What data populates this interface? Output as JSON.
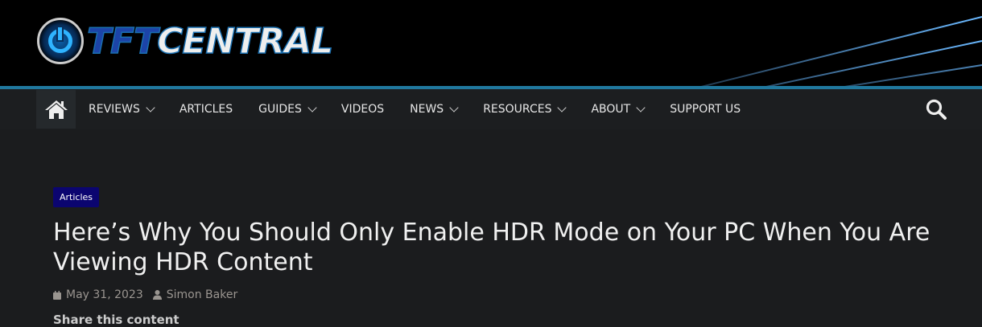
{
  "logo": {
    "part1": "TFT",
    "part2": "CENTRAL"
  },
  "nav": {
    "items": [
      {
        "label": "REVIEWS",
        "dropdown": true
      },
      {
        "label": "ARTICLES",
        "dropdown": false
      },
      {
        "label": "GUIDES",
        "dropdown": true
      },
      {
        "label": "VIDEOS",
        "dropdown": false
      },
      {
        "label": "NEWS",
        "dropdown": true
      },
      {
        "label": "RESOURCES",
        "dropdown": true
      },
      {
        "label": "ABOUT",
        "dropdown": true
      },
      {
        "label": "SUPPORT US",
        "dropdown": false
      }
    ]
  },
  "article": {
    "category": "Articles",
    "title": "Here’s Why You Should Only Enable HDR Mode on Your PC When You Are Viewing HDR Content",
    "date": "May 31, 2023",
    "author": "Simon Baker",
    "share_label": "Share this content"
  },
  "colors": {
    "accent": "#20789e",
    "badge": "#0b0570"
  }
}
